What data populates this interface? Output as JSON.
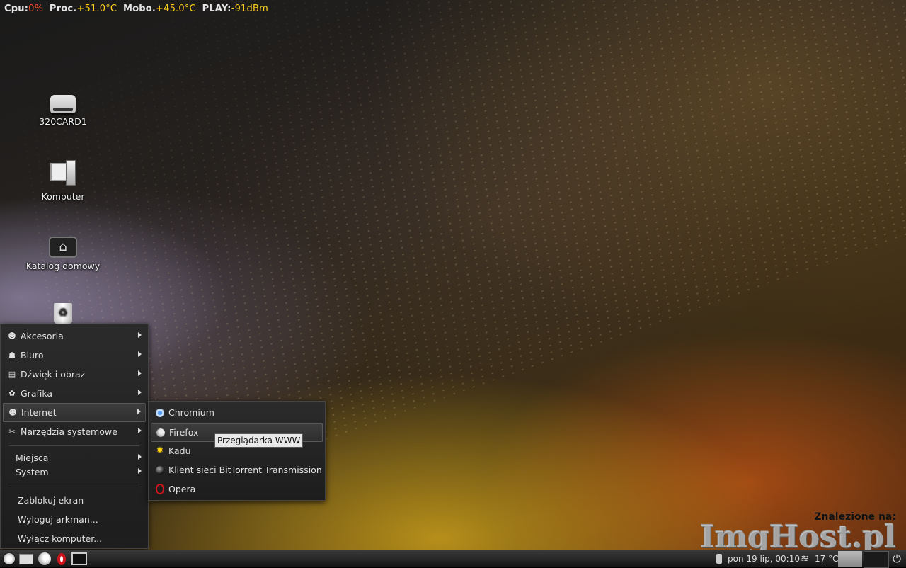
{
  "conky": {
    "cpu_label": "Cpu:",
    "cpu_value": "0%",
    "proc_label": "Proc.",
    "proc_value": "+51.0°C",
    "mobo_label": "Mobo.",
    "mobo_value": "+45.0°C",
    "play_label": "PLAY:",
    "play_value": "-91dBm"
  },
  "desktop_icons": [
    {
      "label": "320CARD1",
      "icon": "drive-icon"
    },
    {
      "label": "Komputer",
      "icon": "computer-icon"
    },
    {
      "label": "Katalog domowy",
      "icon": "home-folder-icon"
    },
    {
      "label": "",
      "icon": "trash-icon"
    }
  ],
  "main_menu": {
    "categories": [
      {
        "label": "Akcesoria",
        "icon": "accessories-icon"
      },
      {
        "label": "Biuro",
        "icon": "office-icon"
      },
      {
        "label": "Dźwięk i obraz",
        "icon": "multimedia-icon"
      },
      {
        "label": "Grafika",
        "icon": "graphics-icon"
      },
      {
        "label": "Internet",
        "icon": "internet-icon"
      },
      {
        "label": "Narzędzia systemowe",
        "icon": "system-tools-icon"
      }
    ],
    "places": [
      "Miejsca",
      "System"
    ],
    "actions": [
      "Zablokuj ekran",
      "Wyloguj arkman...",
      "Wyłącz komputer..."
    ]
  },
  "internet_submenu": [
    {
      "label": "Chromium",
      "icon": "chromium-icon"
    },
    {
      "label": "Firefox",
      "icon": "firefox-icon"
    },
    {
      "label": "Kadu",
      "icon": "kadu-icon"
    },
    {
      "label": "Klient sieci BitTorrent Transmission",
      "icon": "transmission-icon"
    },
    {
      "label": "Opera",
      "icon": "opera-icon"
    }
  ],
  "tooltip": "Przeglądarka WWW",
  "panel": {
    "clock": "pon 19 lip, 00:10",
    "temperature": "17 °C"
  },
  "watermark": {
    "caption": "Znalezione na:",
    "brand": "ImgHost.pl"
  },
  "colors": {
    "conky_red": "#ff4a2a",
    "conky_yellow": "#ffcf1a",
    "opera_red": "#d0141a"
  }
}
